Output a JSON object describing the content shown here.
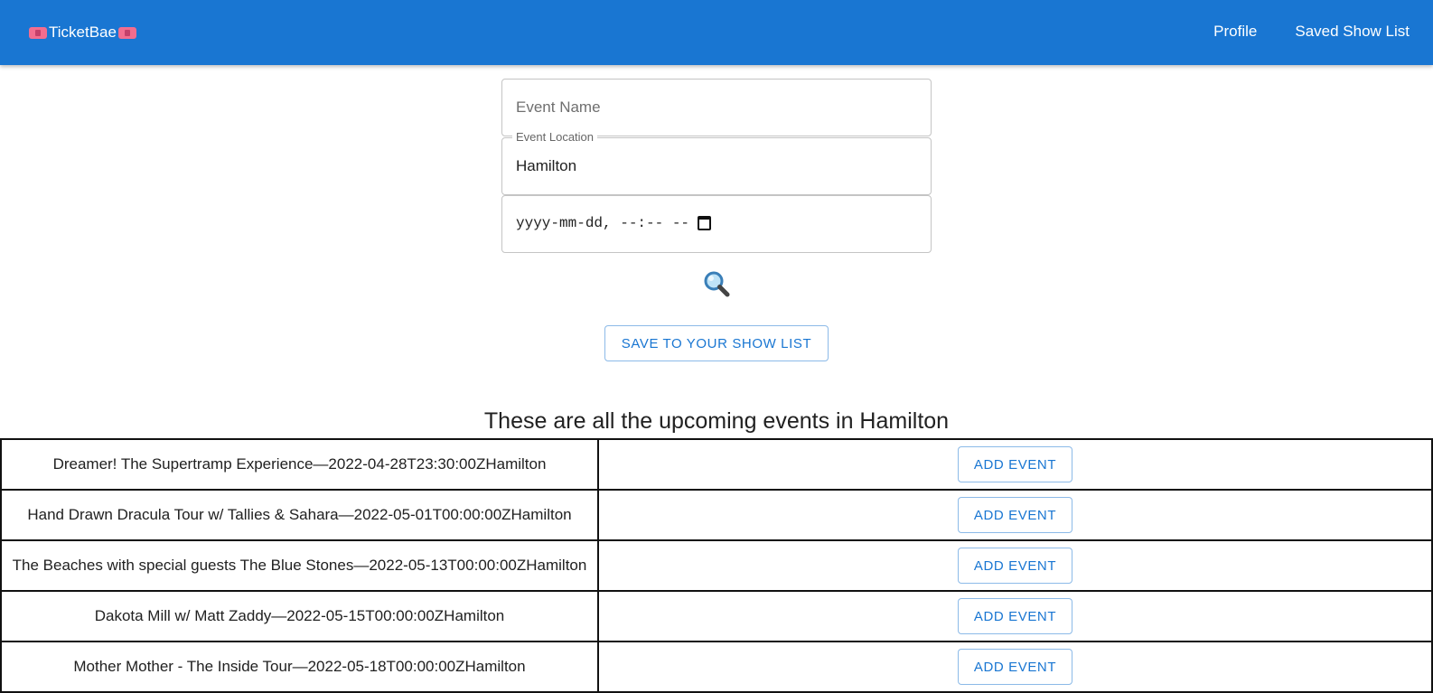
{
  "appbar": {
    "brand": "TicketBae",
    "brand_icon": "ticket-icon",
    "nav": [
      "Profile",
      "Saved Show List"
    ],
    "color": "#1976d2"
  },
  "form": {
    "event_name": {
      "placeholder": "Event Name",
      "value": ""
    },
    "event_location": {
      "label": "Event Location",
      "value": "Hamilton"
    },
    "event_date": {
      "display": "yyyy-mm-dd, --:-- --"
    },
    "search_icon": "magnifying-glass-icon",
    "save_button": "SAVE TO YOUR SHOW LIST"
  },
  "results": {
    "heading": "These are all the upcoming events in Hamilton",
    "events": [
      {
        "name": "Dreamer! The Supertramp Experience—2022-04-28T23:30:00ZHamilton",
        "action": "ADD EVENT"
      },
      {
        "name": "Hand Drawn Dracula Tour w/ Tallies & Sahara—2022-05-01T00:00:00ZHamilton",
        "action": "ADD EVENT"
      },
      {
        "name": "The Beaches with special guests The Blue Stones—2022-05-13T00:00:00ZHamilton",
        "action": "ADD EVENT"
      },
      {
        "name": "Dakota Mill w/ Matt Zaddy—2022-05-15T00:00:00ZHamilton",
        "action": "ADD EVENT"
      },
      {
        "name": "Mother Mother - The Inside Tour—2022-05-18T00:00:00ZHamilton",
        "action": "ADD EVENT"
      }
    ]
  }
}
